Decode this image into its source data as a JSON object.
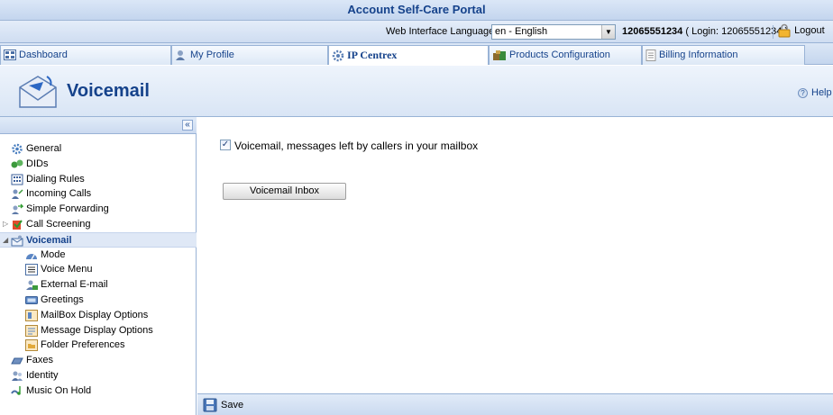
{
  "portal": {
    "title": "Account Self-Care Portal"
  },
  "topbar": {
    "language_label": "Web Interface Language:",
    "language_value": "en - English",
    "account_number": "12065551234",
    "login_text": "( Login: 12065551234 )",
    "logout_label": "Logout"
  },
  "tabs": [
    {
      "label": "Dashboard",
      "icon": "dashboard-icon"
    },
    {
      "label": "My Profile",
      "icon": "user-icon"
    },
    {
      "label": "IP Centrex",
      "icon": "gear-icon",
      "active": true
    },
    {
      "label": "Products Configuration",
      "icon": "products-icon"
    },
    {
      "label": "Billing Information",
      "icon": "document-icon"
    }
  ],
  "header": {
    "title": "Voicemail",
    "help_label": "Help"
  },
  "sidebar": {
    "items": [
      {
        "label": "General",
        "icon": "gear-icon"
      },
      {
        "label": "DIDs",
        "icon": "dids-icon"
      },
      {
        "label": "Dialing Rules",
        "icon": "dialing-rules-icon"
      },
      {
        "label": "Incoming Calls",
        "icon": "incoming-calls-icon"
      },
      {
        "label": "Simple Forwarding",
        "icon": "forwarding-icon"
      },
      {
        "label": "Call Screening",
        "icon": "call-screening-icon"
      },
      {
        "label": "Voicemail",
        "icon": "voicemail-icon"
      },
      {
        "label": "Mode",
        "icon": "mode-icon"
      },
      {
        "label": "Voice Menu",
        "icon": "voice-menu-icon"
      },
      {
        "label": "External E-mail",
        "icon": "email-icon"
      },
      {
        "label": "Greetings",
        "icon": "greetings-icon"
      },
      {
        "label": "MailBox Display Options",
        "icon": "mailbox-icon"
      },
      {
        "label": "Message Display Options",
        "icon": "message-icon"
      },
      {
        "label": "Folder Preferences",
        "icon": "folder-icon"
      },
      {
        "label": "Faxes",
        "icon": "fax-icon"
      },
      {
        "label": "Identity",
        "icon": "identity-icon"
      },
      {
        "label": "Music On Hold",
        "icon": "music-icon"
      }
    ]
  },
  "main": {
    "voicemail_checkbox_label": "Voicemail, messages left by callers in your mailbox",
    "voicemail_checked": true,
    "inbox_button_label": "Voicemail Inbox"
  },
  "footer": {
    "save_label": "Save"
  },
  "colors": {
    "brand_blue": "#15428b",
    "panel_blue": "#dfe8f6",
    "border_blue": "#99b3d6"
  }
}
